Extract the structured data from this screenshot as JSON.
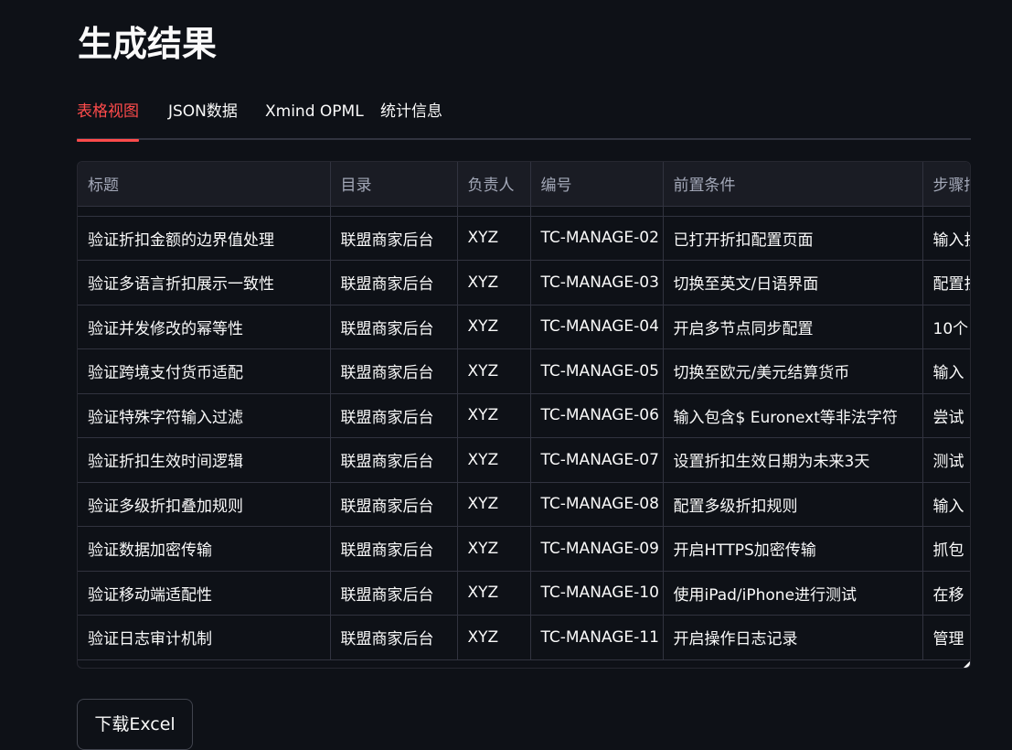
{
  "page": {
    "title": "生成结果"
  },
  "tabs": [
    {
      "label": "表格视图",
      "active": true
    },
    {
      "label": "JSON数据",
      "active": false
    },
    {
      "label": "Xmind OPML",
      "active": false
    },
    {
      "label": "统计信息",
      "active": false
    }
  ],
  "table": {
    "columns": [
      "标题",
      "目录",
      "负责人",
      "编号",
      "前置条件",
      "步骤描述"
    ],
    "rows": [
      [
        "验证折扣金额的边界值处理",
        "联盟商家后台",
        "XYZ",
        "TC-MANAGE-02",
        "已打开折扣配置页面",
        "输入折"
      ],
      [
        "验证多语言折扣展示一致性",
        "联盟商家后台",
        "XYZ",
        "TC-MANAGE-03",
        "切换至英文/日语界面",
        "配置折"
      ],
      [
        "验证并发修改的幂等性",
        "联盟商家后台",
        "XYZ",
        "TC-MANAGE-04",
        "开启多节点同步配置",
        "10个"
      ],
      [
        "验证跨境支付货币适配",
        "联盟商家后台",
        "XYZ",
        "TC-MANAGE-05",
        "切换至欧元/美元结算货币",
        "输入"
      ],
      [
        "验证特殊字符输入过滤",
        "联盟商家后台",
        "XYZ",
        "TC-MANAGE-06",
        "输入包含$ Euronext等非法字符",
        "尝试"
      ],
      [
        "验证折扣生效时间逻辑",
        "联盟商家后台",
        "XYZ",
        "TC-MANAGE-07",
        "设置折扣生效日期为未来3天",
        "测试"
      ],
      [
        "验证多级折扣叠加规则",
        "联盟商家后台",
        "XYZ",
        "TC-MANAGE-08",
        "配置多级折扣规则",
        "输入"
      ],
      [
        "验证数据加密传输",
        "联盟商家后台",
        "XYZ",
        "TC-MANAGE-09",
        "开启HTTPS加密传输",
        "抓包"
      ],
      [
        "验证移动端适配性",
        "联盟商家后台",
        "XYZ",
        "TC-MANAGE-10",
        "使用iPad/iPhone进行测试",
        "在移"
      ],
      [
        "验证日志审计机制",
        "联盟商家后台",
        "XYZ",
        "TC-MANAGE-11",
        "开启操作日志记录",
        "管理"
      ]
    ]
  },
  "download": {
    "label": "下载Excel"
  },
  "colors": {
    "background": "#0e1117",
    "accent": "#ff4b4b",
    "header_bg": "#1a1c24",
    "border": "#31333f"
  }
}
